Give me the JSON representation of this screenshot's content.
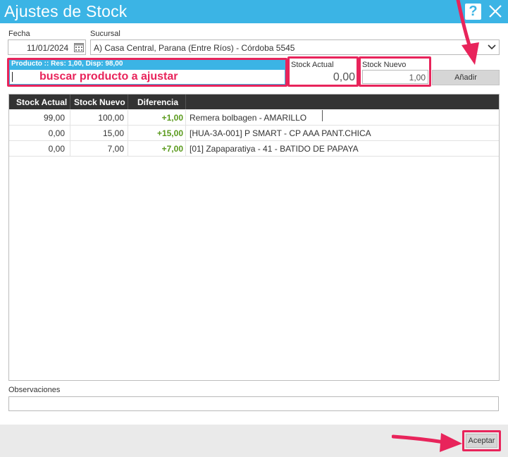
{
  "window": {
    "title": "Ajustes de Stock",
    "help_label": "?"
  },
  "form": {
    "fecha_label": "Fecha",
    "fecha_value": "11/01/2024",
    "sucursal_label": "Sucursal",
    "sucursal_value": "A) Casa Central, Parana (Entre Ríos) - Córdoba 5545"
  },
  "producto": {
    "header": "Producto :: Res: 1,00, Disp: 98,00",
    "hint": "buscar producto a ajustar",
    "value": ""
  },
  "stock_actual": {
    "label": "Stock Actual",
    "value": "0,00"
  },
  "stock_nuevo": {
    "label": "Stock Nuevo",
    "value": "1,00"
  },
  "add_button": "Añadir",
  "grid": {
    "columns": [
      "Stock Actual",
      "Stock Nuevo",
      "Diferencia",
      ""
    ],
    "rows": [
      {
        "actual": "99,00",
        "nuevo": "100,00",
        "diferencia": "+1,00",
        "producto": "Remera bolbagen - AMARILLO"
      },
      {
        "actual": "0,00",
        "nuevo": "15,00",
        "diferencia": "+15,00",
        "producto": "[HUA-3A-001] P SMART - CP AAA PANT.CHICA"
      },
      {
        "actual": "0,00",
        "nuevo": "7,00",
        "diferencia": "+7,00",
        "producto": "[01] Zapaparatiya - 41 - BATIDO DE PAPAYA"
      }
    ]
  },
  "observaciones": {
    "label": "Observaciones",
    "value": ""
  },
  "accept_button": "Aceptar",
  "colors": {
    "titlebar": "#3bb4e5",
    "highlight": "#e8245b",
    "positive": "#5a9a1c",
    "grid_header": "#333333"
  }
}
